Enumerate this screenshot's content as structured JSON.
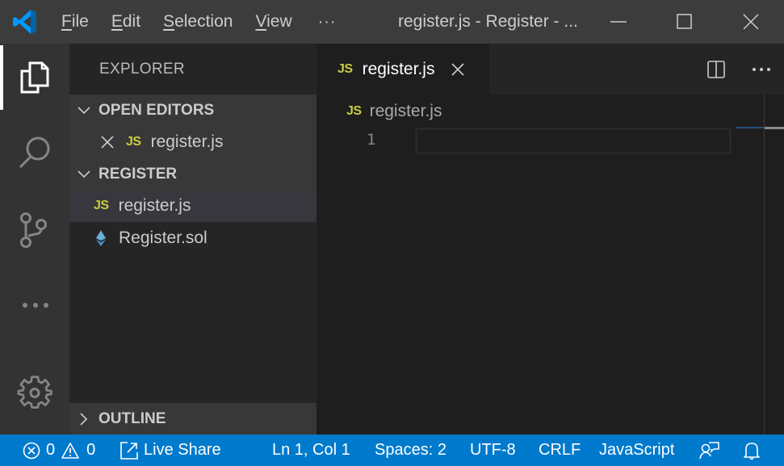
{
  "titlebar": {
    "menu": [
      {
        "label": "File",
        "mnemonic": "F",
        "rest": "ile"
      },
      {
        "label": "Edit",
        "mnemonic": "E",
        "rest": "dit"
      },
      {
        "label": "Selection",
        "mnemonic": "S",
        "rest": "election"
      },
      {
        "label": "View",
        "mnemonic": "V",
        "rest": "iew"
      }
    ],
    "more": "···",
    "window_title": "register.js - Register - ...",
    "logo_color": "#0078d4"
  },
  "activitybar": {
    "items": [
      {
        "name": "explorer",
        "icon": "files-icon",
        "active": true
      },
      {
        "name": "search",
        "icon": "search-icon",
        "active": false
      },
      {
        "name": "source-control",
        "icon": "source-control-icon",
        "active": false
      },
      {
        "name": "more",
        "icon": "more-icon",
        "active": false
      }
    ],
    "settings_icon": "gear-icon"
  },
  "sidebar": {
    "title": "EXPLORER",
    "open_editors": {
      "header": "OPEN EDITORS",
      "items": [
        {
          "badge": "JS",
          "label": "register.js"
        }
      ]
    },
    "folder": {
      "header": "REGISTER",
      "items": [
        {
          "badge": "JS",
          "label": "register.js",
          "selected": true
        },
        {
          "badge": "solidity-icon",
          "label": "Register.sol",
          "selected": false
        }
      ]
    },
    "outline": {
      "header": "OUTLINE"
    }
  },
  "editor": {
    "tab": {
      "badge": "JS",
      "label": "register.js"
    },
    "breadcrumb": {
      "badge": "JS",
      "label": "register.js"
    },
    "lines": [
      {
        "number": "1",
        "text": ""
      }
    ]
  },
  "statusbar": {
    "errors": "0",
    "warnings": "0",
    "live_share": "Live Share",
    "position": "Ln 1, Col 1",
    "spaces": "Spaces: 2",
    "encoding": "UTF-8",
    "eol": "CRLF",
    "language": "JavaScript",
    "background_color": "#007acc"
  }
}
